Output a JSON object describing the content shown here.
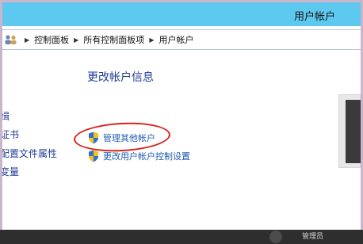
{
  "window": {
    "title": "用户帐户"
  },
  "breadcrumb": {
    "icon": "users-control-panel-icon",
    "items": [
      "控制面板",
      "所有控制面板项",
      "用户帐户"
    ]
  },
  "main": {
    "heading": "更改帐户信息",
    "tasks": [
      {
        "label": "管理其他帐户",
        "icon": "uac-shield-icon"
      },
      {
        "label": "更改用户帐户控制设置",
        "icon": "uac-shield-icon"
      }
    ]
  },
  "sidebar": {
    "items": [
      "缉",
      "证书",
      "配置文件属性",
      "变量"
    ]
  },
  "taskbar": {
    "user_text": "管理员"
  },
  "colors": {
    "titlebar": "#5ec9ef",
    "link": "#1e5bb5",
    "heading": "#1e3c96",
    "highlight": "#d9201a",
    "taskbar": "#2e2e2e"
  }
}
